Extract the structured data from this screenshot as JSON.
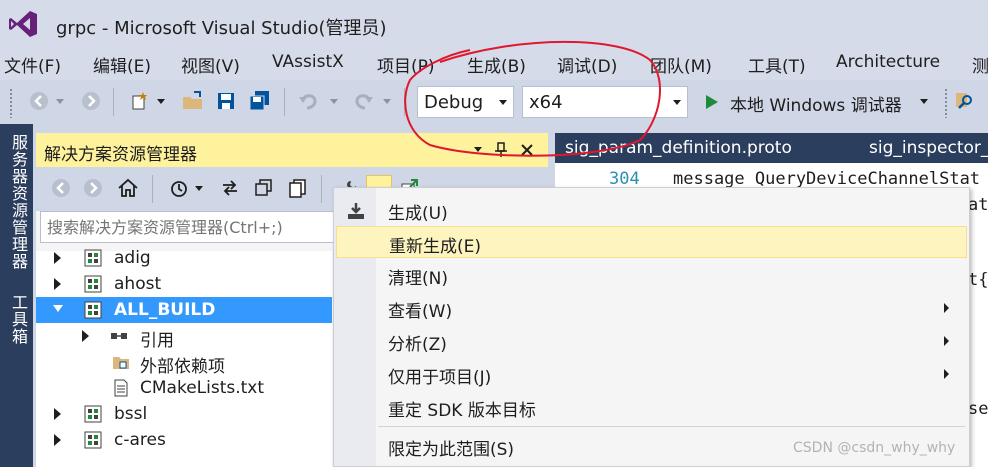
{
  "window": {
    "title": "grpc - Microsoft Visual Studio(管理员)"
  },
  "menubar": {
    "items": [
      "文件(F)",
      "编辑(E)",
      "视图(V)",
      "VAssistX",
      "项目(P)",
      "生成(B)",
      "调试(D)",
      "团队(M)",
      "工具(T)",
      "Architecture",
      "测"
    ]
  },
  "toolbar": {
    "config_value": "Debug",
    "platform_value": "x64",
    "run_label": "本地 Windows 调试器"
  },
  "vertical_tabs": [
    "服务器资源管理器",
    "工具箱"
  ],
  "solution_explorer": {
    "title": "解决方案资源管理器",
    "search_placeholder": "搜索解决方案资源管理器(Ctrl+;)",
    "tree": [
      {
        "label": "adig",
        "level": 1,
        "selected": false
      },
      {
        "label": "ahost",
        "level": 1,
        "selected": false
      },
      {
        "label": "ALL_BUILD",
        "level": 1,
        "selected": true
      },
      {
        "label": "引用",
        "level": 2,
        "selected": false
      },
      {
        "label": "外部依赖项",
        "level": 2,
        "selected": false
      },
      {
        "label": "CMakeLists.txt",
        "level": 2,
        "selected": false
      },
      {
        "label": "bssl",
        "level": 1,
        "selected": false
      },
      {
        "label": "c-ares",
        "level": 1,
        "selected": false
      }
    ]
  },
  "editor": {
    "tabs": [
      "sig_param_definition.proto",
      "sig_inspector_"
    ],
    "line_number": "304",
    "code_line": "message QueryDeviceChannelStat",
    "fragments": [
      "at",
      "t{",
      "se"
    ]
  },
  "context_menu": {
    "items": [
      {
        "label": "生成(U)",
        "submenu": false,
        "highlighted": false
      },
      {
        "label": "重新生成(E)",
        "submenu": false,
        "highlighted": true
      },
      {
        "label": "清理(N)",
        "submenu": false,
        "highlighted": false
      },
      {
        "label": "查看(W)",
        "submenu": true,
        "highlighted": false
      },
      {
        "label": "分析(Z)",
        "submenu": true,
        "highlighted": false
      },
      {
        "label": "仅用于项目(J)",
        "submenu": true,
        "highlighted": false
      },
      {
        "label": "重定 SDK 版本目标",
        "submenu": false,
        "highlighted": false
      },
      {
        "label": "限定为此范围(S)",
        "submenu": false,
        "highlighted": false
      }
    ]
  },
  "watermark": "CSDN @csdn_why_why",
  "colors": {
    "vs_purple": "#68217a",
    "selection_blue": "#3399ff",
    "panel_title_yellow": "#fff29d",
    "dark_navy": "#2c3e5e",
    "annotation_red": "#e0182d",
    "run_green": "#1f8a3a"
  }
}
